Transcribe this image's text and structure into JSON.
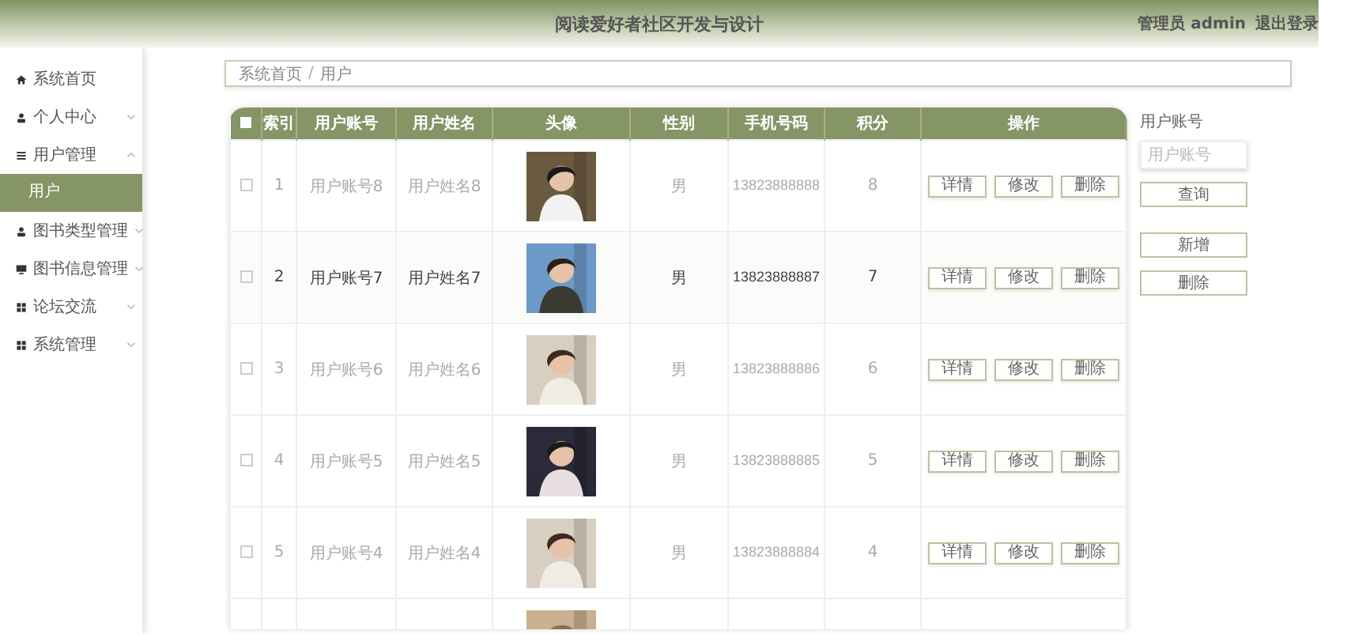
{
  "header": {
    "title": "阅读爱好者社区开发与设计",
    "user": "管理员 admin",
    "logout": "退出登录"
  },
  "sidebar": {
    "items": [
      {
        "label": "系统首页"
      },
      {
        "label": "个人中心",
        "expanded": false
      },
      {
        "label": "用户管理",
        "expanded": true,
        "children": [
          {
            "label": "用户",
            "selected": true
          }
        ]
      },
      {
        "label": "图书类型管理",
        "expanded": false
      },
      {
        "label": "图书信息管理",
        "expanded": false
      },
      {
        "label": "论坛交流",
        "expanded": false
      },
      {
        "label": "系统管理",
        "expanded": false
      }
    ]
  },
  "breadcrumb": {
    "items": [
      "系统首页",
      "用户"
    ],
    "separator": "/"
  },
  "table": {
    "header_checkbox": {
      "checked": false
    },
    "columns": [
      "索引",
      "用户账号",
      "用户姓名",
      "头像",
      "性别",
      "手机号码",
      "积分",
      "操作"
    ],
    "rows": [
      {
        "checked": false,
        "highlighted": false,
        "index": "1",
        "account": "用户账号8",
        "name": "用户姓名8",
        "avatar": {
          "kind": "picture"
        },
        "gender": "男",
        "phone": "13823888888",
        "points": "8",
        "actions": [
          "详情",
          "修改",
          "删除"
        ]
      },
      {
        "checked": false,
        "highlighted": true,
        "index": "2",
        "account": "用户账号7",
        "name": "用户姓名7",
        "avatar": {
          "kind": "picture"
        },
        "gender": "男",
        "phone": "13823888887",
        "points": "7",
        "actions": [
          "详情",
          "修改",
          "删除"
        ]
      },
      {
        "checked": false,
        "highlighted": false,
        "index": "3",
        "account": "用户账号6",
        "name": "用户姓名6",
        "avatar": {
          "kind": "picture"
        },
        "gender": "男",
        "phone": "13823888886",
        "points": "6",
        "actions": [
          "详情",
          "修改",
          "删除"
        ]
      },
      {
        "checked": false,
        "highlighted": false,
        "index": "4",
        "account": "用户账号5",
        "name": "用户姓名5",
        "avatar": {
          "kind": "picture"
        },
        "gender": "男",
        "phone": "13823888885",
        "points": "5",
        "actions": [
          "详情",
          "修改",
          "删除"
        ]
      },
      {
        "checked": false,
        "highlighted": false,
        "index": "5",
        "account": "用户账号4",
        "name": "用户姓名4",
        "avatar": {
          "kind": "picture"
        },
        "gender": "男",
        "phone": "13823888884",
        "points": "4",
        "actions": [
          "详情",
          "修改",
          "删除"
        ]
      },
      {
        "avatar": {
          "kind": "picture"
        }
      }
    ]
  },
  "search": {
    "label": "用户账号",
    "placeholder": "用户账号",
    "query_button": "查询",
    "add_button": "新增",
    "delete_button": "删除"
  }
}
